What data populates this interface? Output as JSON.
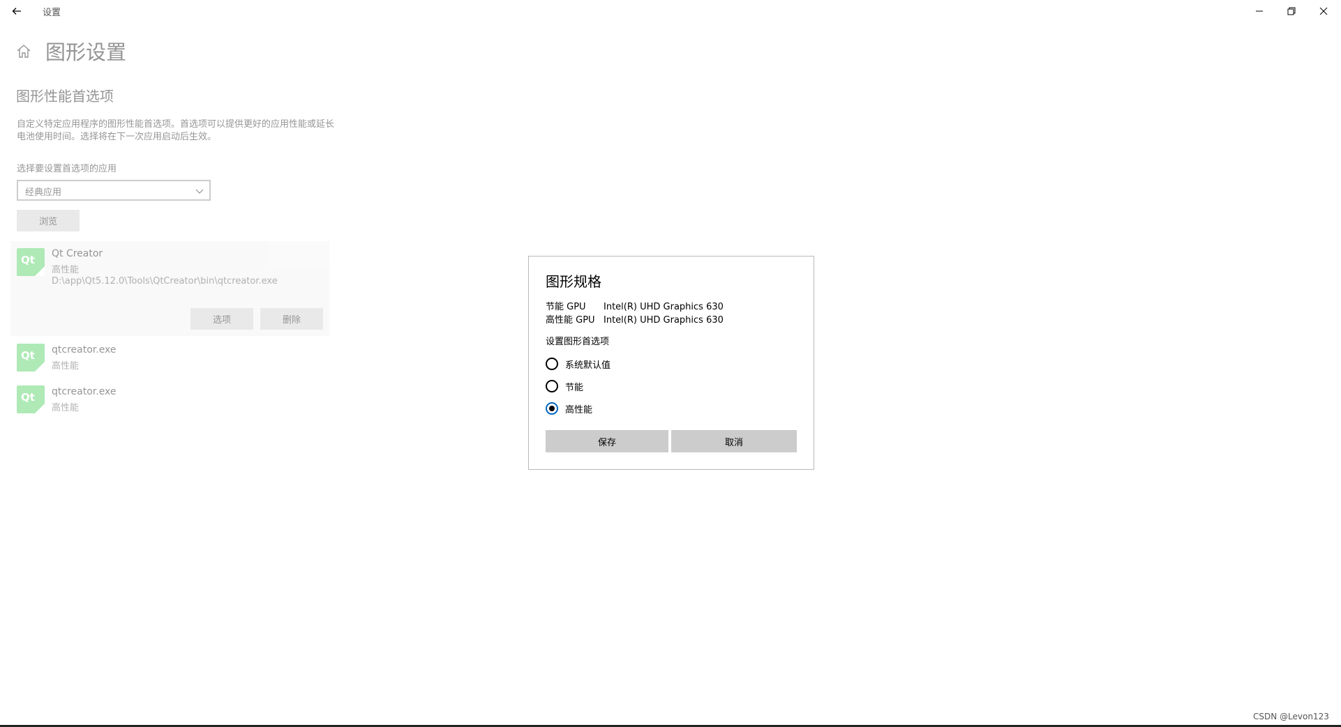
{
  "titlebar": {
    "title": "设置"
  },
  "page": {
    "title": "图形设置",
    "section_title": "图形性能首选项",
    "description": "自定义特定应用程序的图形性能首选项。首选项可以提供更好的应用性能或延长电池使用时间。选择将在下一次应用启动后生效。",
    "select_label": "选择要设置首选项的应用",
    "dropdown_value": "经典应用",
    "browse_label": "浏览"
  },
  "apps": [
    {
      "name": "Qt Creator",
      "preference": "高性能",
      "path": "D:\\app\\Qt5.12.0\\Tools\\QtCreator\\bin\\qtcreator.exe",
      "options_label": "选项",
      "delete_label": "删除"
    },
    {
      "name": "qtcreator.exe",
      "preference": "高性能"
    },
    {
      "name": "qtcreator.exe",
      "preference": "高性能"
    }
  ],
  "dialog": {
    "title": "图形规格",
    "gpus": [
      {
        "key": "节能 GPU",
        "value": "Intel(R) UHD Graphics 630"
      },
      {
        "key": "高性能 GPU",
        "value": "Intel(R) UHD Graphics 630"
      }
    ],
    "pref_label": "设置图形首选项",
    "options": [
      {
        "label": "系统默认值",
        "checked": false
      },
      {
        "label": "节能",
        "checked": false
      },
      {
        "label": "高性能",
        "checked": true
      }
    ],
    "save_label": "保存",
    "cancel_label": "取消"
  },
  "app_icon_text": "Qt",
  "watermark": "CSDN @Levon123",
  "colors": {
    "accent": "#0067c0",
    "button_bg": "#cccccc",
    "qt_green": "#41cd52"
  }
}
